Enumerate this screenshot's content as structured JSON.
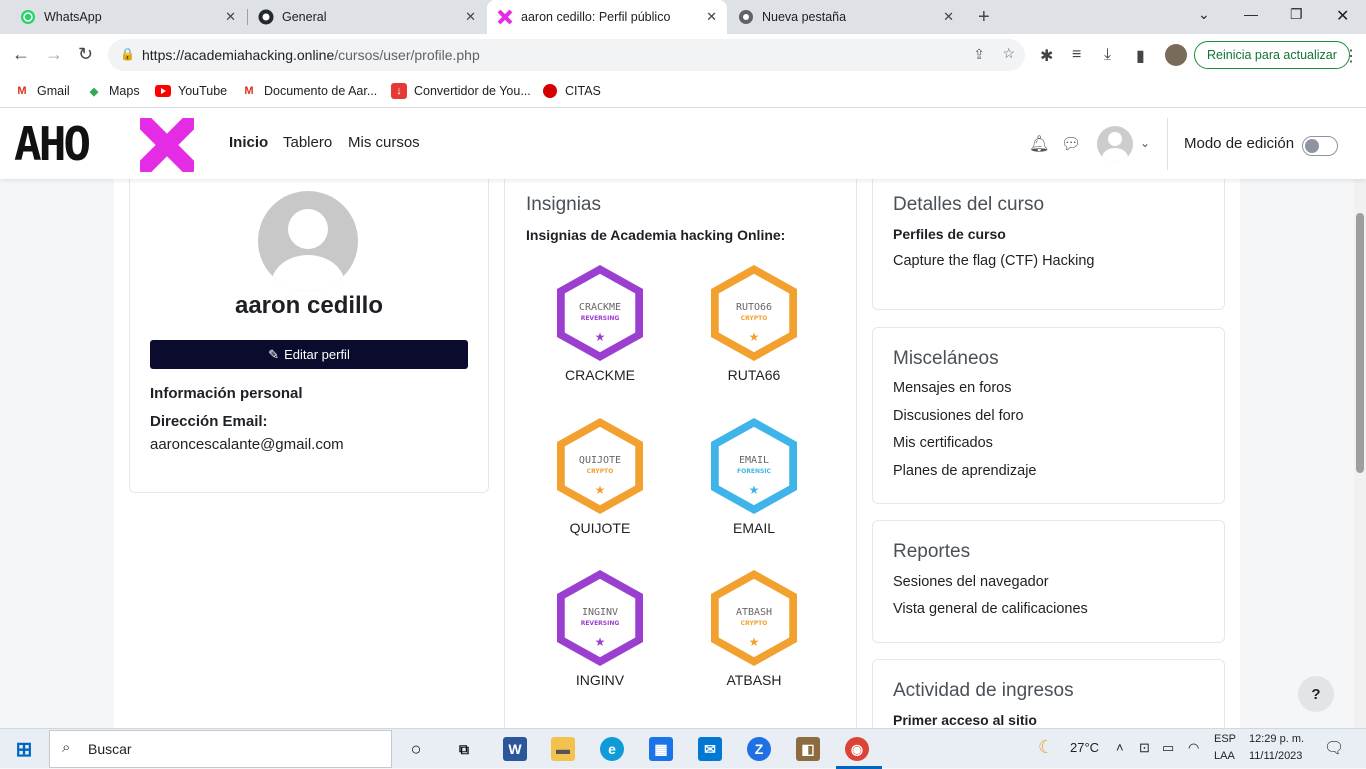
{
  "browser": {
    "tabs": [
      {
        "title": "WhatsApp",
        "icon": "whatsapp-icon"
      },
      {
        "title": "General",
        "icon": "github-icon"
      },
      {
        "title": "aaron cedillo: Perfil público",
        "icon": "aho-x-icon"
      },
      {
        "title": "Nueva pestaña",
        "icon": "chrome-icon"
      }
    ],
    "url_host": "https://academiahacking.online",
    "url_path": "/cursos/user/profile.php",
    "restart_label": "Reinicia para actualizar",
    "bookmarks": [
      "Gmail",
      "Maps",
      "YouTube",
      "Documento de Aar...",
      "Convertidor de You...",
      "CITAS"
    ]
  },
  "site": {
    "logo_text": "AHO",
    "nav": [
      "Inicio",
      "Tablero",
      "Mis cursos"
    ],
    "edit_mode_label": "Modo de edición"
  },
  "profile": {
    "name": "aaron cedillo",
    "edit_button": "Editar perfil",
    "personal_info": "Información personal",
    "email_label": "Dirección Email:",
    "email": "aaroncescalante@gmail.com"
  },
  "badges": {
    "heading": "Insignias",
    "subheading": "Insignias de Academia hacking Online:",
    "items": [
      {
        "name": "CRACKME",
        "inner": "CRACKME",
        "sub": "REVERSING",
        "color": "#9b3fd1"
      },
      {
        "name": "RUTA66",
        "inner": "RUTO66",
        "sub": "CRYPTO",
        "color": "#f2a12f"
      },
      {
        "name": "QUIJOTE",
        "inner": "QUIJOTE",
        "sub": "CRYPTO",
        "color": "#f2a12f"
      },
      {
        "name": "EMAIL",
        "inner": "EMAIL",
        "sub": "FORENSIC",
        "color": "#3fb4e8"
      },
      {
        "name": "INGINV",
        "inner": "INGINV",
        "sub": "REVERSING",
        "color": "#9b3fd1"
      },
      {
        "name": "ATBASH",
        "inner": "ATBASH",
        "sub": "CRYPTO",
        "color": "#f2a12f"
      }
    ]
  },
  "course_details": {
    "heading": "Detalles del curso",
    "label": "Perfiles de curso",
    "course": "Capture the flag (CTF) Hacking"
  },
  "misc": {
    "heading": "Misceláneos",
    "links": [
      "Mensajes en foros",
      "Discusiones del foro",
      "Mis certificados",
      "Planes de aprendizaje"
    ]
  },
  "reports": {
    "heading": "Reportes",
    "links": [
      "Sesiones del navegador",
      "Vista general de calificaciones"
    ]
  },
  "activity": {
    "heading": "Actividad de ingresos",
    "first_access": "Primer acceso al sitio"
  },
  "help_label": "?",
  "taskbar": {
    "search": "Buscar",
    "weather": "27°C",
    "lang1": "ESP",
    "lang2": "LAA",
    "time": "12:29 p. m.",
    "date": "11/11/2023"
  }
}
